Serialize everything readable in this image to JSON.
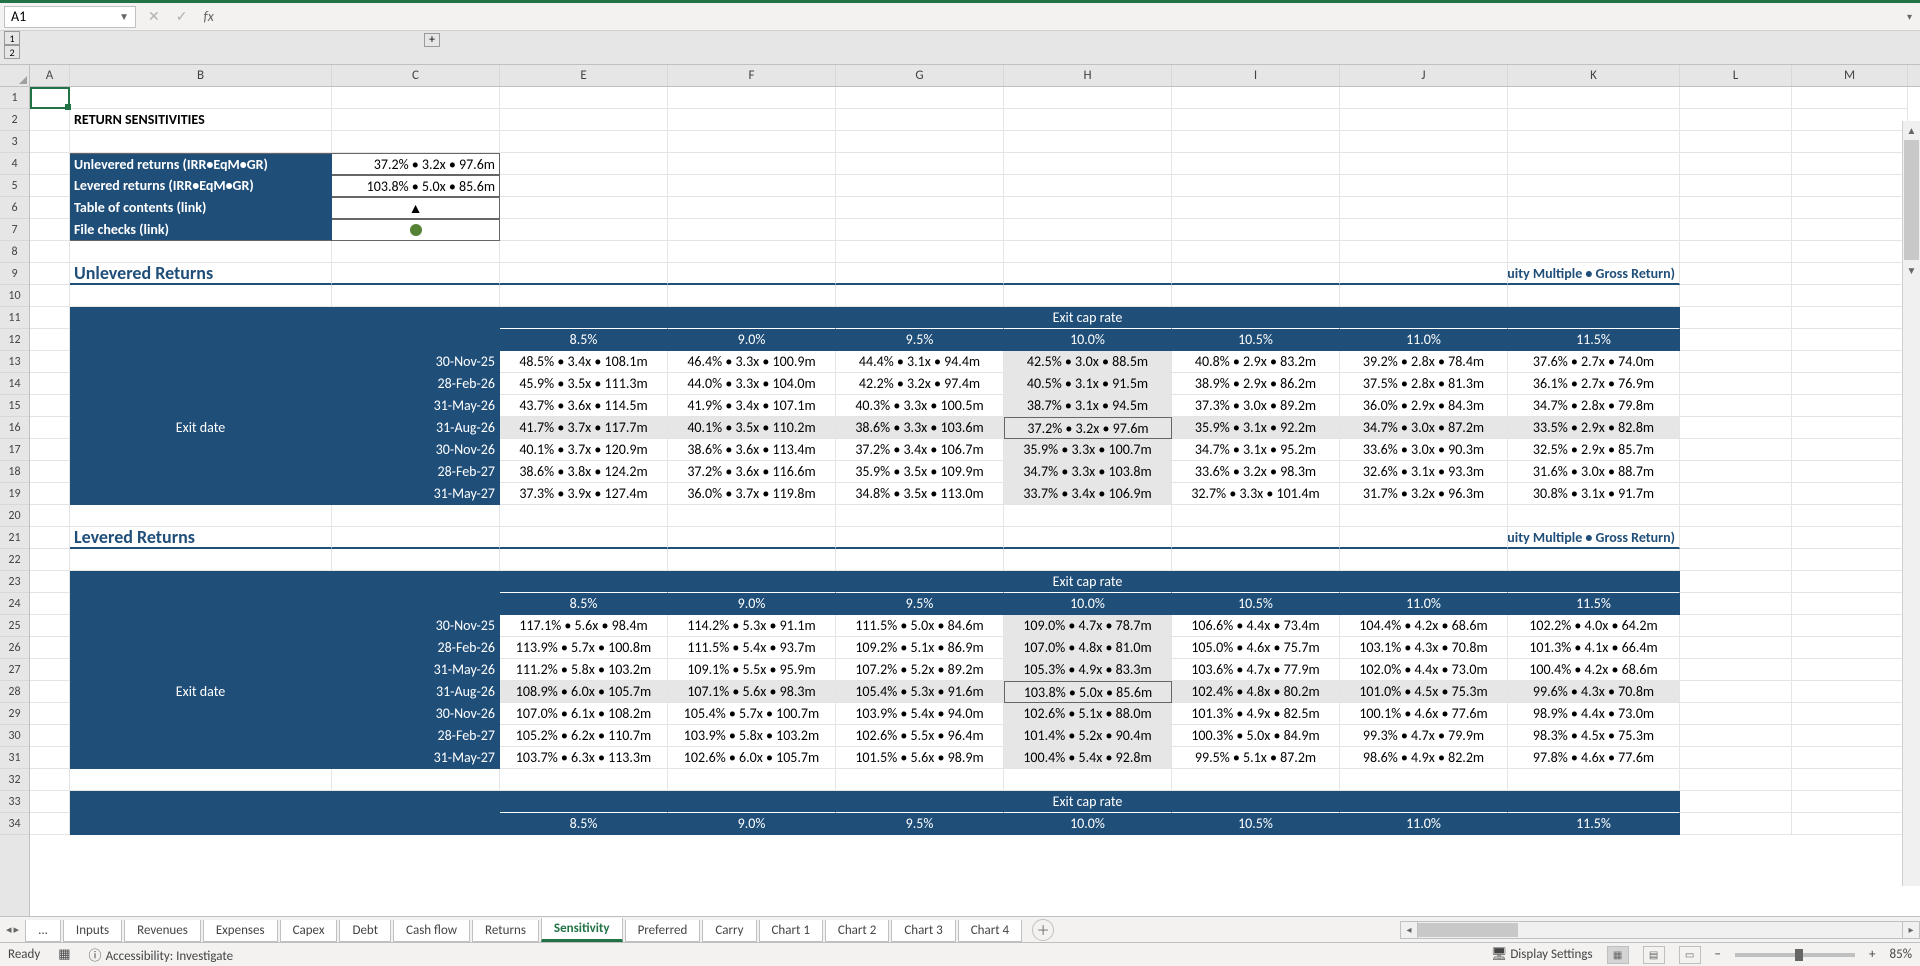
{
  "nameBox": "A1",
  "title": "RETURN SENSITIVITIES",
  "summary": {
    "unlev_label": "Unlevered returns (IRR•EqM•GR)",
    "unlev_value": "37.2% • 3.2x • 97.6m",
    "lev_label": "Levered returns (IRR•EqM•GR)",
    "lev_value": "103.8% • 5.0x • 85.6m",
    "toc_label": "Table of contents (link)",
    "toc_symbol": "▲",
    "checks_label": "File checks (link)"
  },
  "section1": {
    "title": "Unlevered Returns",
    "right": "(IRR • Equity Multiple • Gross Return)"
  },
  "section2": {
    "title": "Levered Returns",
    "right": "(IRR • Equity Multiple • Gross Return)"
  },
  "axis": {
    "col_label": "Exit cap rate",
    "row_label": "Exit date"
  },
  "cap_rates": [
    "8.5%",
    "9.0%",
    "9.5%",
    "10.0%",
    "10.5%",
    "11.0%",
    "11.5%"
  ],
  "dates": [
    "30-Nov-25",
    "28-Feb-26",
    "31-May-26",
    "31-Aug-26",
    "30-Nov-26",
    "28-Feb-27",
    "31-May-27"
  ],
  "unlev": [
    [
      "48.5% • 3.4x • 108.1m",
      "46.4% • 3.3x • 100.9m",
      "44.4% • 3.1x • 94.4m",
      "42.5% • 3.0x • 88.5m",
      "40.8% • 2.9x • 83.2m",
      "39.2% • 2.8x • 78.4m",
      "37.6% • 2.7x • 74.0m"
    ],
    [
      "45.9% • 3.5x • 111.3m",
      "44.0% • 3.3x • 104.0m",
      "42.2% • 3.2x • 97.4m",
      "40.5% • 3.1x • 91.5m",
      "38.9% • 2.9x • 86.2m",
      "37.5% • 2.8x • 81.3m",
      "36.1% • 2.7x • 76.9m"
    ],
    [
      "43.7% • 3.6x • 114.5m",
      "41.9% • 3.4x • 107.1m",
      "40.3% • 3.3x • 100.5m",
      "38.7% • 3.1x • 94.5m",
      "37.3% • 3.0x • 89.2m",
      "36.0% • 2.9x • 84.3m",
      "34.7% • 2.8x • 79.8m"
    ],
    [
      "41.7% • 3.7x • 117.7m",
      "40.1% • 3.5x • 110.2m",
      "38.6% • 3.3x • 103.6m",
      "37.2% • 3.2x • 97.6m",
      "35.9% • 3.1x • 92.2m",
      "34.7% • 3.0x • 87.2m",
      "33.5% • 2.9x • 82.8m"
    ],
    [
      "40.1% • 3.7x • 120.9m",
      "38.6% • 3.6x • 113.4m",
      "37.2% • 3.4x • 106.7m",
      "35.9% • 3.3x • 100.7m",
      "34.7% • 3.1x • 95.2m",
      "33.6% • 3.0x • 90.3m",
      "32.5% • 2.9x • 85.7m"
    ],
    [
      "38.6% • 3.8x • 124.2m",
      "37.2% • 3.6x • 116.6m",
      "35.9% • 3.5x • 109.9m",
      "34.7% • 3.3x • 103.8m",
      "33.6% • 3.2x • 98.3m",
      "32.6% • 3.1x • 93.3m",
      "31.6% • 3.0x • 88.7m"
    ],
    [
      "37.3% • 3.9x • 127.4m",
      "36.0% • 3.7x • 119.8m",
      "34.8% • 3.5x • 113.0m",
      "33.7% • 3.4x • 106.9m",
      "32.7% • 3.3x • 101.4m",
      "31.7% • 3.2x • 96.3m",
      "30.8% • 3.1x • 91.7m"
    ]
  ],
  "lev": [
    [
      "117.1% • 5.6x • 98.4m",
      "114.2% • 5.3x • 91.1m",
      "111.5% • 5.0x • 84.6m",
      "109.0% • 4.7x • 78.7m",
      "106.6% • 4.4x • 73.4m",
      "104.4% • 4.2x • 68.6m",
      "102.2% • 4.0x • 64.2m"
    ],
    [
      "113.9% • 5.7x • 100.8m",
      "111.5% • 5.4x • 93.7m",
      "109.2% • 5.1x • 86.9m",
      "107.0% • 4.8x • 81.0m",
      "105.0% • 4.6x • 75.7m",
      "103.1% • 4.3x • 70.8m",
      "101.3% • 4.1x • 66.4m"
    ],
    [
      "111.2% • 5.8x • 103.2m",
      "109.1% • 5.5x • 95.9m",
      "107.2% • 5.2x • 89.2m",
      "105.3% • 4.9x • 83.3m",
      "103.6% • 4.7x • 77.9m",
      "102.0% • 4.4x • 73.0m",
      "100.4% • 4.2x • 68.6m"
    ],
    [
      "108.9% • 6.0x • 105.7m",
      "107.1% • 5.6x • 98.3m",
      "105.4% • 5.3x • 91.6m",
      "103.8% • 5.0x • 85.6m",
      "102.4% • 4.8x • 80.2m",
      "101.0% • 4.5x • 75.3m",
      "99.6% • 4.3x • 70.8m"
    ],
    [
      "107.0% • 6.1x • 108.2m",
      "105.4% • 5.7x • 100.7m",
      "103.9% • 5.4x • 94.0m",
      "102.6% • 5.1x • 88.0m",
      "101.3% • 4.9x • 82.5m",
      "100.1% • 4.6x • 77.6m",
      "98.9% • 4.4x • 73.0m"
    ],
    [
      "105.2% • 6.2x • 110.7m",
      "103.9% • 5.8x • 103.2m",
      "102.6% • 5.5x • 96.4m",
      "101.4% • 5.2x • 90.4m",
      "100.3% • 5.0x • 84.9m",
      "99.3% • 4.7x • 79.9m",
      "98.3% • 4.5x • 75.3m"
    ],
    [
      "103.7% • 6.3x • 113.3m",
      "102.6% • 6.0x • 105.7m",
      "101.5% • 5.6x • 98.9m",
      "100.4% • 5.4x • 92.8m",
      "99.5% • 5.1x • 87.2m",
      "98.6% • 4.9x • 82.2m",
      "97.8% • 4.6x • 77.6m"
    ]
  ],
  "columns": [
    "A",
    "B",
    "C",
    "E",
    "F",
    "G",
    "H",
    "I",
    "J",
    "K",
    "L",
    "M"
  ],
  "sheets": [
    "...",
    "Inputs",
    "Revenues",
    "Expenses",
    "Capex",
    "Debt",
    "Cash flow",
    "Returns",
    "Sensitivity",
    "Preferred",
    "Carry",
    "Chart 1",
    "Chart 2",
    "Chart 3",
    "Chart 4"
  ],
  "activeSheet": "Sensitivity",
  "status": {
    "ready": "Ready",
    "acc": "Accessibility: Investigate",
    "disp": "Display Settings",
    "zoom": "85%"
  }
}
